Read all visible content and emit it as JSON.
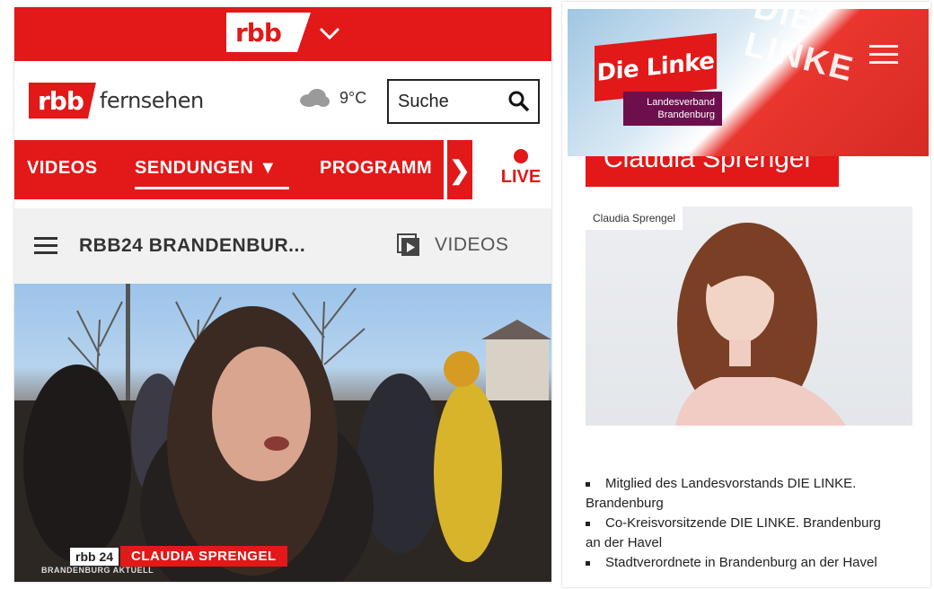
{
  "left_panel": {
    "top_logo": "rbb",
    "brand": {
      "rbb": "rbb",
      "fernsehen": "fernsehen"
    },
    "weather": {
      "temperature": "9°C",
      "icon": "cloud-icon"
    },
    "search": {
      "placeholder": "Suche"
    },
    "nav": {
      "items": [
        "VIDEOS",
        "SENDUNGEN ▼",
        "PROGRAMM"
      ],
      "live": "LIVE",
      "arrow": "❯"
    },
    "subbar": {
      "title": "RBB24 BRANDENBUR...",
      "videos": "VIDEOS"
    },
    "video": {
      "tag": "rbb 24",
      "name": "CLAUDIA SPRENGEL",
      "program": "BRANDENBURG AKTUELL"
    },
    "colors": {
      "accent": "#e31818"
    }
  },
  "right_panel": {
    "logo": {
      "title": "Die Linke",
      "sub1": "Landesverband",
      "sub2": "Brandenburg"
    },
    "flag_text": "DIE LINKE",
    "heading": "Claudia Sprengel",
    "photo_caption": "Claudia Sprengel",
    "bullets": [
      {
        "line1": "Mitglied des Landesvorstands DIE LINKE.",
        "line2": "Brandenburg"
      },
      {
        "line1": "Co-Kreisvorsitzende DIE LINKE. Brandenburg",
        "line2": "an der Havel"
      },
      {
        "line1": "Stadtverordnete in Brandenburg an der Havel",
        "line2": ""
      }
    ],
    "colors": {
      "red": "#e31818",
      "purple": "#6e0f4d"
    }
  }
}
